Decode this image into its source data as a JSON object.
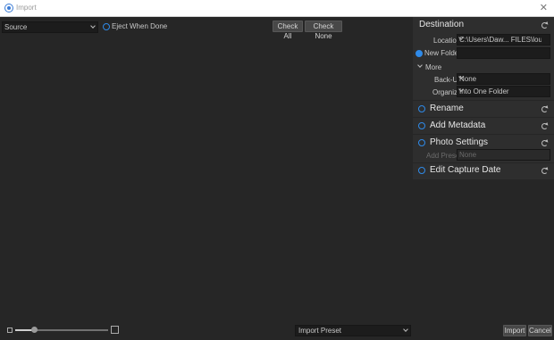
{
  "window": {
    "title": "Import",
    "close_glyph": "✕",
    "icon": "app-circle-icon"
  },
  "toolbar": {
    "source_label": "Source",
    "eject_label": "Eject When Done",
    "check_all": "Check All",
    "check_none": "Check None"
  },
  "bottom": {
    "import_preset_label": "Import Preset",
    "import_button": "Import",
    "cancel_button": "Cancel"
  },
  "panel": {
    "destination": {
      "title": "Destination",
      "location_label": "Location",
      "location_value": "C:\\Users\\Daw... FILES\\loupe",
      "new_folder_label": "New Folder",
      "more_label": "More",
      "backup_label": "Back-Up",
      "backup_value": "None",
      "organize_label": "Organize",
      "organize_value": "Into One Folder"
    },
    "rename": {
      "title": "Rename"
    },
    "metadata": {
      "title": "Add Metadata"
    },
    "photo_settings": {
      "title": "Photo Settings",
      "add_preset_label": "Add Preset",
      "add_preset_value": "None"
    },
    "capture_date": {
      "title": "Edit Capture Date"
    }
  },
  "colors": {
    "accent": "#2f8ae8",
    "background": "#262626",
    "panel": "#2e2e2e"
  }
}
